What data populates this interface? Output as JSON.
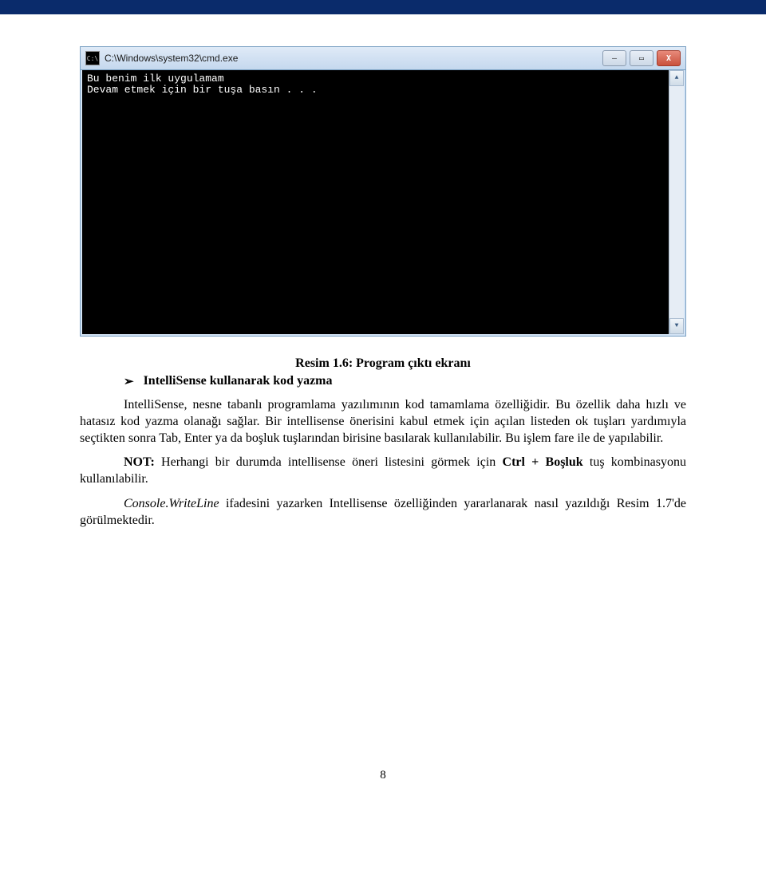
{
  "topbar_color": "#0a2b6b",
  "window": {
    "title": "C:\\Windows\\system32\\cmd.exe",
    "icon_label": "C:\\",
    "console_lines": "Bu benim ilk uygulamam\nDevam etmek için bir tuşa basın . . .",
    "btn_min": "—",
    "btn_max": "▭",
    "btn_close": "X",
    "scroll_up": "▲",
    "scroll_down": "▼"
  },
  "caption": "Resim 1.6: Program çıktı ekranı",
  "bullet": {
    "arrow": "➢",
    "text": "IntelliSense kullanarak kod yazma"
  },
  "para1": "IntelliSense, nesne tabanlı programlama yazılımının kod tamamlama özelliğidir. Bu özellik daha hızlı ve hatasız kod yazma olanağı sağlar. Bir intellisense önerisini kabul etmek için açılan listeden ok tuşları yardımıyla seçtikten sonra Tab, Enter ya da boşluk tuşlarından birisine basılarak kullanılabilir. Bu işlem fare ile de yapılabilir.",
  "para2_prefix": "NOT:",
  "para2_rest": " Herhangi bir durumda intellisense öneri listesini görmek için ",
  "para2_bold2": "Ctrl + Boşluk",
  "para2_tail": " tuş kombinasyonu kullanılabilir.",
  "para3_italic": "Console.WriteLine",
  "para3_tail": " ifadesini yazarken Intellisense özelliğinden yararlanarak nasıl yazıldığı Resim 1.7'de görülmektedir.",
  "page_number": "8"
}
